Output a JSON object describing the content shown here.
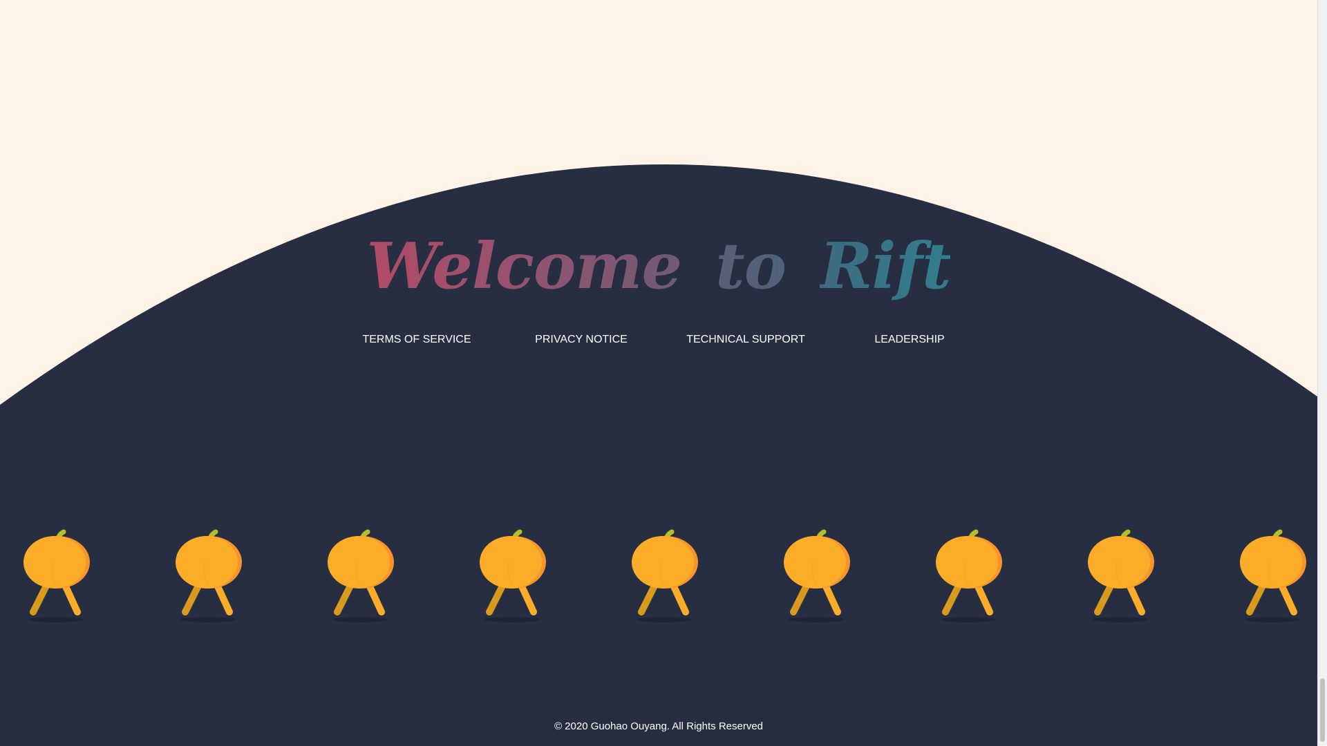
{
  "footer": {
    "title_words": [
      "Welcome",
      "to",
      "Rift"
    ],
    "nav": [
      {
        "label": "TERMS OF SERVICE"
      },
      {
        "label": "PRIVACY NOTICE"
      },
      {
        "label": "TECHNICAL SUPPORT"
      },
      {
        "label": "LEADERSHIP"
      }
    ],
    "decoration": {
      "icon": "pumpkin-icon",
      "count": 9
    },
    "copyright": "© 2020 Guohao Ouyang. All Rights Reserved"
  },
  "colors": {
    "page_background": "#fff3e8",
    "footer_background": "#282e42",
    "title_gradient": [
      "#b24a67",
      "#317e8d"
    ],
    "pumpkin": "#fbad2a",
    "pumpkin_shade": "#f7942b",
    "pumpkin_leg": "#d89b1f",
    "pumpkin_stem": "#b6bf2a",
    "link_text": "#ffffff"
  }
}
